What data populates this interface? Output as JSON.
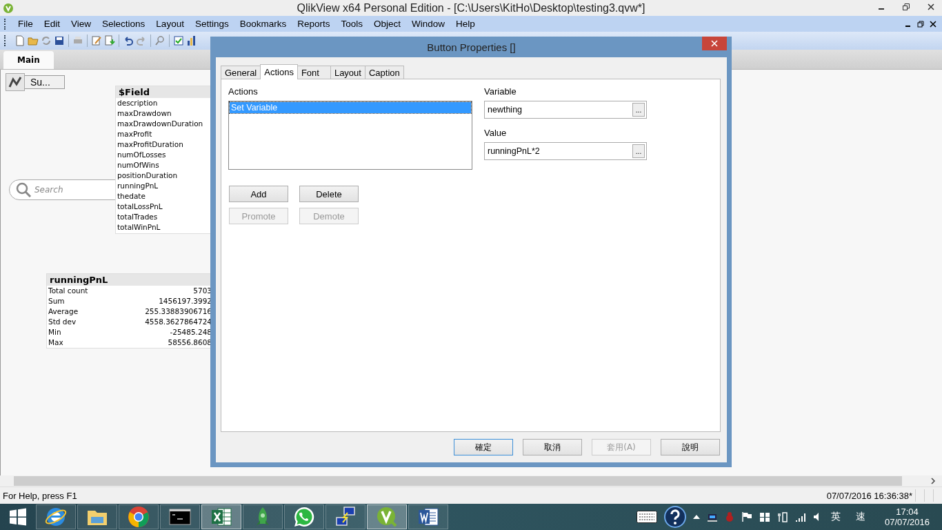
{
  "window": {
    "title": "QlikView x64 Personal Edition - [C:\\Users\\KitHo\\Desktop\\testing3.qvw*]"
  },
  "menu": [
    "File",
    "Edit",
    "View",
    "Selections",
    "Layout",
    "Settings",
    "Bookmarks",
    "Reports",
    "Tools",
    "Object",
    "Window",
    "Help"
  ],
  "sheet_tabs": [
    {
      "label": "Main",
      "selected": true
    }
  ],
  "sheet": {
    "button": "Su...",
    "search": {
      "placeholder": "Search"
    },
    "field_list": {
      "title": "$Field",
      "items": [
        "description",
        "maxDrawdown",
        "maxDrawdownDuration",
        "maxProfit",
        "maxProfitDuration",
        "numOfLosses",
        "numOfWins",
        "positionDuration",
        "runningPnL",
        "thedate",
        "totalLossPnL",
        "totalTrades",
        "totalWinPnL"
      ]
    },
    "stats_box": {
      "title": "runningPnL",
      "rows": [
        {
          "label": "Total count",
          "value": "5703"
        },
        {
          "label": "Sum",
          "value": "1456197.3992"
        },
        {
          "label": "Average",
          "value": "255.33883906716"
        },
        {
          "label": "Std dev",
          "value": "4558.3627864724"
        },
        {
          "label": "Min",
          "value": "-25485.248"
        },
        {
          "label": "Max",
          "value": "58556.8608"
        }
      ]
    }
  },
  "dialog": {
    "title": "Button Properties []",
    "tabs": [
      {
        "label": "General",
        "selected": false
      },
      {
        "label": "Actions",
        "selected": true
      },
      {
        "label": "Font",
        "selected": false
      },
      {
        "label": "Layout",
        "selected": false
      },
      {
        "label": "Caption",
        "selected": false
      }
    ],
    "actions_label": "Actions",
    "actions": [
      {
        "label": "Set Variable",
        "selected": true
      }
    ],
    "action_buttons": [
      {
        "label": "Add",
        "disabled": false
      },
      {
        "label": "Delete",
        "disabled": false
      },
      {
        "label": "Promote",
        "disabled": true
      },
      {
        "label": "Demote",
        "disabled": true
      }
    ],
    "fields": [
      {
        "label": "Variable",
        "value": "newthing",
        "button": "..."
      },
      {
        "label": "Value",
        "value": "runningPnL*2",
        "button": "..."
      }
    ],
    "footer_buttons": [
      {
        "label": "確定",
        "disabled": false,
        "default": true
      },
      {
        "label": "取消",
        "disabled": false,
        "default": false
      },
      {
        "label": "套用(A)",
        "disabled": true,
        "default": false
      },
      {
        "label": "說明",
        "disabled": false,
        "default": false
      }
    ]
  },
  "status_bar": {
    "help": "For Help, press F1",
    "timestamp": "07/07/2016 16:36:38*"
  },
  "taskbar": {
    "apps": [
      {
        "kind": "globe",
        "active": false
      },
      {
        "kind": "folder",
        "active": false
      },
      {
        "kind": "ball",
        "active": false
      },
      {
        "kind": "terminal",
        "active": false
      },
      {
        "kind": "sheet",
        "active": true
      },
      {
        "kind": "rocket",
        "active": false
      },
      {
        "kind": "chat",
        "active": false
      },
      {
        "kind": "network",
        "active": false
      },
      {
        "kind": "v-logo",
        "active": true
      },
      {
        "kind": "document",
        "active": false
      }
    ],
    "ime": [
      "英",
      "速"
    ],
    "time": "17:04",
    "date": "07/07/2016"
  }
}
